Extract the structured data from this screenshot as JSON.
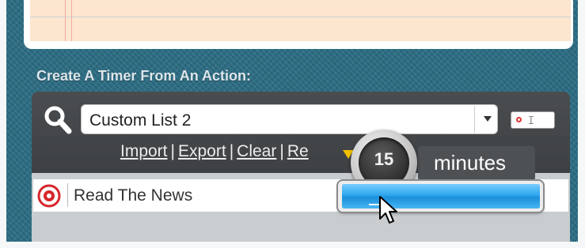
{
  "section": {
    "title": "Create A Timer From An Action:"
  },
  "search": {
    "selected_list": "Custom List 2"
  },
  "actions": {
    "import": "Import",
    "export": "Export",
    "clear": "Clear",
    "partial": "Re"
  },
  "list": {
    "items": [
      {
        "label": "Read The News"
      }
    ]
  },
  "timer": {
    "value": "15",
    "unit": "minutes"
  },
  "slider": {
    "fill_fraction": 1.0
  },
  "colors": {
    "panel": "#44474a",
    "accent_blue": "#2ea6ee",
    "pointer": "#f2c200",
    "note": "#fde6cf"
  },
  "icons": {
    "search": "magnifier-icon",
    "erase": "erase-icon",
    "item": "target-icon",
    "cursor": "mouse-pointer-icon"
  }
}
